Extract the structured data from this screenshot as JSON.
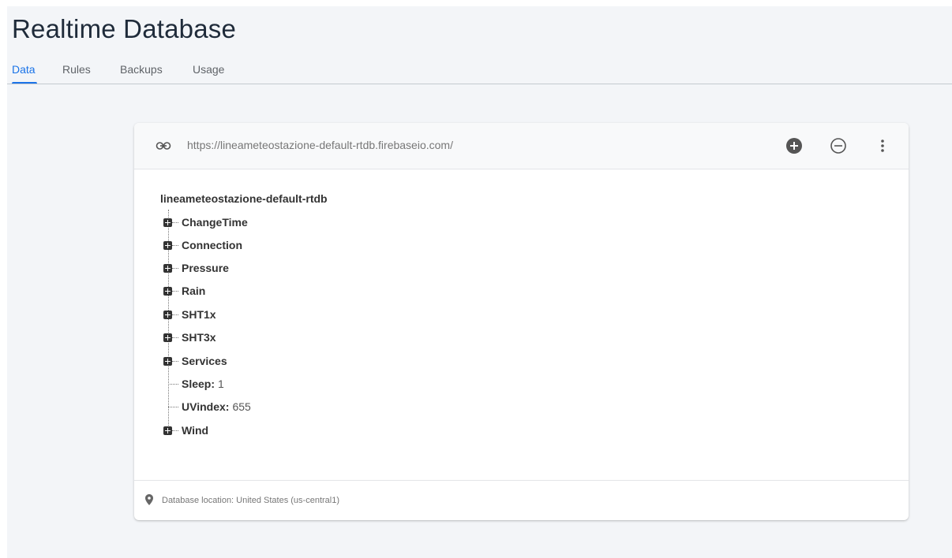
{
  "page": {
    "title": "Realtime Database"
  },
  "tabs": [
    {
      "label": "Data",
      "active": true
    },
    {
      "label": "Rules",
      "active": false
    },
    {
      "label": "Backups",
      "active": false
    },
    {
      "label": "Usage",
      "active": false
    }
  ],
  "header": {
    "url": "https://lineameteostazione-default-rtdb.firebaseio.com/",
    "icons": [
      "link-icon",
      "add-circle-icon",
      "remove-circle-icon",
      "more-vert-icon"
    ]
  },
  "tree": {
    "root": "lineameteostazione-default-rtdb",
    "nodes": [
      {
        "key": "ChangeTime",
        "expandable": true
      },
      {
        "key": "Connection",
        "expandable": true
      },
      {
        "key": "Pressure",
        "expandable": true
      },
      {
        "key": "Rain",
        "expandable": true
      },
      {
        "key": "SHT1x",
        "expandable": true
      },
      {
        "key": "SHT3x",
        "expandable": true
      },
      {
        "key": "Services",
        "expandable": true
      },
      {
        "key": "Sleep:",
        "value": "1",
        "expandable": false
      },
      {
        "key": "UVindex:",
        "value": "655",
        "expandable": false
      },
      {
        "key": "Wind",
        "expandable": true
      }
    ]
  },
  "footer": {
    "location": "Database location: United States (us-central1)"
  },
  "colors": {
    "accent": "#1a73e8",
    "background": "#f3f5f8"
  }
}
